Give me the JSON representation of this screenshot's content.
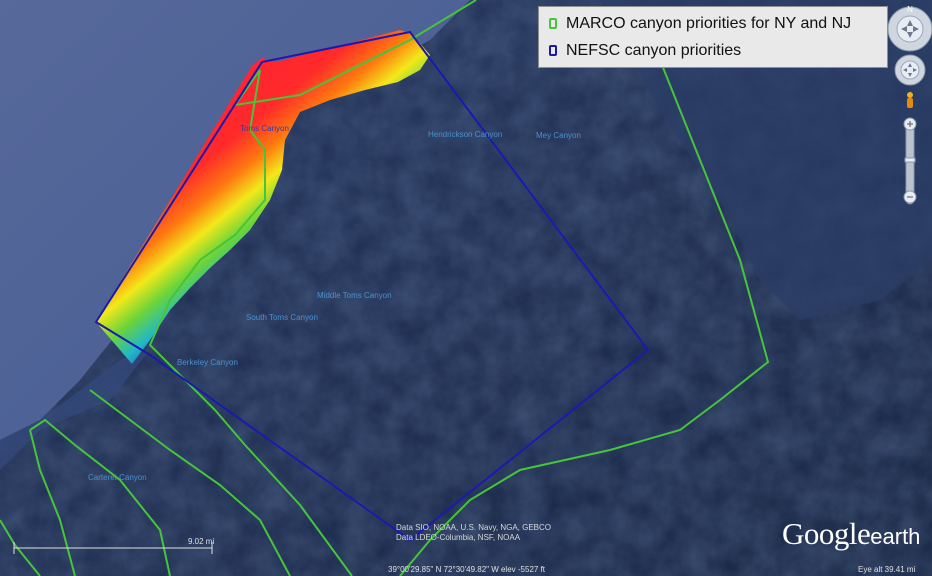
{
  "legend": {
    "items": [
      {
        "label": "MARCO canyon priorities for NY and NJ",
        "color": "#46c43c"
      },
      {
        "label": "NEFSC canyon priorities",
        "color": "#1a1a9e"
      }
    ]
  },
  "canyons": {
    "toms": "Toms Canyon",
    "hendrickson": "Hendrickson Canyon",
    "mey": "Mey Canyon",
    "middle_toms": "Middle Toms Canyon",
    "south_toms": "South Toms Canyon",
    "berkeley": "Berkeley Canyon",
    "carteret": "Carteret Canyon"
  },
  "attribution": {
    "line1": "Data SIO, NOAA, U.S. Navy, NGA, GEBCO",
    "line2": "Data LDEO-Columbia, NSF, NOAA"
  },
  "status_bar": {
    "coords": "39°00'29.85\" N  72°30'49.82\" W  elev -5527 ft",
    "eye_alt": "Eye alt    39.41 mi"
  },
  "scale": {
    "label": "9.02 mi"
  },
  "branding": {
    "logo_main": "Google",
    "logo_sub": "earth"
  },
  "controls": {
    "north": "N"
  },
  "colors": {
    "marco": "#46c43c",
    "nefsc": "#1a1a9e",
    "ocean_deep": "#1a2a4e",
    "shelf": "#4a6aa0"
  }
}
